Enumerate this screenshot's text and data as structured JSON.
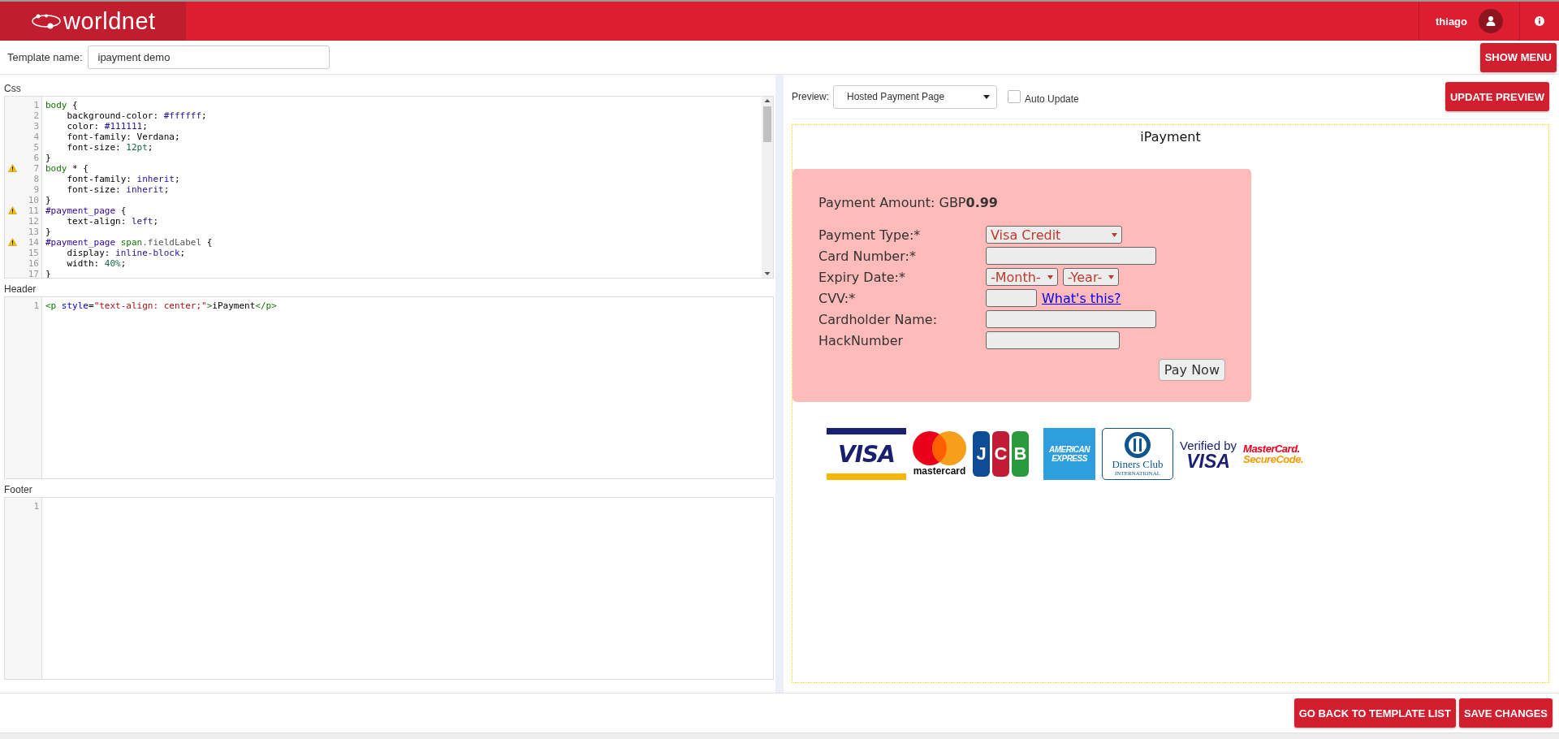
{
  "top_bar": {
    "brand": "worldnet",
    "user": "thiago"
  },
  "template_name": {
    "label": "Template name:",
    "value": "ipayment demo"
  },
  "show_menu_button": "SHOW MENU",
  "editors": [
    {
      "label": "Css",
      "scrollbar": true,
      "lines": [
        {
          "number": "1",
          "warning": false,
          "tokens": [
            {
              "kind": "tag",
              "text": "body"
            },
            {
              "kind": "plain",
              "text": " {"
            }
          ]
        },
        {
          "number": "2",
          "warning": false,
          "tokens": [
            {
              "kind": "plain",
              "text": "    background-color: "
            },
            {
              "kind": "atom",
              "text": "#ffffff"
            },
            {
              "kind": "plain",
              "text": ";"
            }
          ]
        },
        {
          "number": "3",
          "warning": false,
          "tokens": [
            {
              "kind": "plain",
              "text": "    color: "
            },
            {
              "kind": "atom",
              "text": "#111111"
            },
            {
              "kind": "plain",
              "text": ";"
            }
          ]
        },
        {
          "number": "4",
          "warning": false,
          "tokens": [
            {
              "kind": "plain",
              "text": "    font-family: Verdana;"
            }
          ]
        },
        {
          "number": "5",
          "warning": false,
          "tokens": [
            {
              "kind": "plain",
              "text": "    font-size: "
            },
            {
              "kind": "number",
              "text": "12pt"
            },
            {
              "kind": "plain",
              "text": ";"
            }
          ]
        },
        {
          "number": "6",
          "warning": false,
          "tokens": [
            {
              "kind": "plain",
              "text": "}"
            }
          ]
        },
        {
          "number": "7",
          "warning": true,
          "tokens": [
            {
              "kind": "tag",
              "text": "body"
            },
            {
              "kind": "plain",
              "text": " * {"
            }
          ]
        },
        {
          "number": "8",
          "warning": false,
          "tokens": [
            {
              "kind": "plain",
              "text": "    font-family: "
            },
            {
              "kind": "atom",
              "text": "inherit"
            },
            {
              "kind": "plain",
              "text": ";"
            }
          ]
        },
        {
          "number": "9",
          "warning": false,
          "tokens": [
            {
              "kind": "plain",
              "text": "    font-size: "
            },
            {
              "kind": "atom",
              "text": "inherit"
            },
            {
              "kind": "plain",
              "text": ";"
            }
          ]
        },
        {
          "number": "10",
          "warning": false,
          "tokens": [
            {
              "kind": "plain",
              "text": "}"
            }
          ]
        },
        {
          "number": "11",
          "warning": true,
          "tokens": [
            {
              "kind": "builtin",
              "text": "#payment_page"
            },
            {
              "kind": "plain",
              "text": " {"
            }
          ]
        },
        {
          "number": "12",
          "warning": false,
          "tokens": [
            {
              "kind": "plain",
              "text": "    text-align: "
            },
            {
              "kind": "atom",
              "text": "left"
            },
            {
              "kind": "plain",
              "text": ";"
            }
          ]
        },
        {
          "number": "13",
          "warning": false,
          "tokens": [
            {
              "kind": "plain",
              "text": "}"
            }
          ]
        },
        {
          "number": "14",
          "warning": true,
          "tokens": [
            {
              "kind": "builtin",
              "text": "#payment_page"
            },
            {
              "kind": "tag",
              "text": " span"
            },
            {
              "kind": "qualifier",
              "text": ".fieldLabel"
            },
            {
              "kind": "plain",
              "text": " {"
            }
          ]
        },
        {
          "number": "15",
          "warning": false,
          "tokens": [
            {
              "kind": "plain",
              "text": "    display: "
            },
            {
              "kind": "atom",
              "text": "inline-block"
            },
            {
              "kind": "plain",
              "text": ";"
            }
          ]
        },
        {
          "number": "16",
          "warning": false,
          "tokens": [
            {
              "kind": "plain",
              "text": "    width: "
            },
            {
              "kind": "number",
              "text": "40%"
            },
            {
              "kind": "plain",
              "text": ";"
            }
          ]
        },
        {
          "number": "17",
          "warning": false,
          "tokens": [
            {
              "kind": "plain",
              "text": "}"
            }
          ]
        }
      ]
    },
    {
      "label": "Header",
      "scrollbar": false,
      "lines": [
        {
          "number": "1",
          "warning": false,
          "tokens": [
            {
              "kind": "tag",
              "text": "<p"
            },
            {
              "kind": "attribute",
              "text": " style"
            },
            {
              "kind": "plain",
              "text": "="
            },
            {
              "kind": "string",
              "text": "\"text-align: center;\""
            },
            {
              "kind": "tag",
              "text": ">"
            },
            {
              "kind": "plain",
              "text": "iPayment"
            },
            {
              "kind": "tag",
              "text": "</p>"
            }
          ]
        }
      ]
    },
    {
      "label": "Footer",
      "scrollbar": false,
      "lines": [
        {
          "number": "1",
          "warning": false
        }
      ]
    }
  ],
  "preview": {
    "label": "Preview:",
    "select": "Hosted Payment Page",
    "auto_update": {
      "label": "Auto Update",
      "checked": false
    },
    "update_button": "UPDATE PREVIEW",
    "page_title": "iPayment",
    "amount": "Payment Amount: GBP**0.99**",
    "fields": [
      {
        "label": "Payment Type:*",
        "kind": "select",
        "values": [
          "Visa Credit"
        ]
      },
      {
        "label": "Card Number:*",
        "kind": "input"
      },
      {
        "label": "Expiry Date:*",
        "kind": "double-select",
        "values": [
          "-Month-",
          "-Year-"
        ]
      },
      {
        "label": "CVV:*",
        "kind": "cvv",
        "link": "What's this?"
      },
      {
        "label": "Cardholder Name:",
        "kind": "input"
      },
      {
        "label": "HackNumber",
        "kind": "short-input"
      }
    ],
    "pay_button": "Pay Now",
    "logos": [
      {
        "kind": "visa",
        "lines": [
          "VISA"
        ]
      },
      {
        "kind": "mastercard",
        "lines": [
          "mastercard"
        ]
      },
      {
        "kind": "jcb",
        "lines": [
          "J",
          "C",
          "B"
        ]
      },
      {
        "kind": "amex",
        "lines": [
          "AMERICAN",
          "EXPRESS"
        ]
      },
      {
        "kind": "diners",
        "lines": [
          "Diners Club",
          "INTERNATIONAL"
        ]
      },
      {
        "kind": "verified-visa",
        "lines": [
          "Verified by",
          "VISA"
        ]
      },
      {
        "kind": "securecode",
        "lines": [
          "MasterCard.",
          "SecureCode."
        ]
      }
    ]
  },
  "footer_buttons": [
    "GO BACK TO TEMPLATE LIST",
    "SAVE CHANGES"
  ]
}
